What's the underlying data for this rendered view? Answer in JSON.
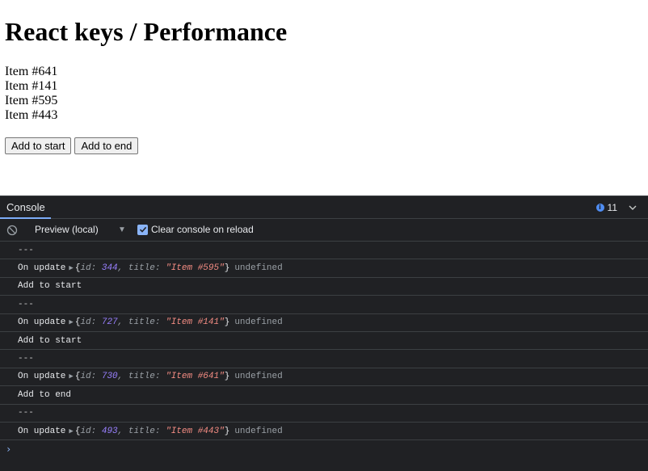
{
  "page": {
    "title": "React keys / Performance",
    "items": [
      "Item #641",
      "Item #141",
      "Item #595",
      "Item #443"
    ],
    "buttons": {
      "add_start": "Add to start",
      "add_end": "Add to end"
    }
  },
  "devtools": {
    "tab_label": "Console",
    "info_count": "11",
    "context_label": "Preview (local)",
    "clear_on_reload_label": "Clear console on reload",
    "clear_on_reload_checked": true,
    "log": [
      {
        "type": "text",
        "text": "---"
      },
      {
        "type": "update",
        "label": "On update",
        "id": "344",
        "title": "\"Item #595\"",
        "suffix": "undefined"
      },
      {
        "type": "text",
        "text": "Add to start"
      },
      {
        "type": "text",
        "text": "---"
      },
      {
        "type": "update",
        "label": "On update",
        "id": "727",
        "title": "\"Item #141\"",
        "suffix": "undefined"
      },
      {
        "type": "text",
        "text": "Add to start"
      },
      {
        "type": "text",
        "text": "---"
      },
      {
        "type": "update",
        "label": "On update",
        "id": "730",
        "title": "\"Item #641\"",
        "suffix": "undefined"
      },
      {
        "type": "text",
        "text": "Add to end"
      },
      {
        "type": "text",
        "text": "---"
      },
      {
        "type": "update",
        "label": "On update",
        "id": "493",
        "title": "\"Item #443\"",
        "suffix": "undefined"
      }
    ],
    "prompt_symbol": "›",
    "colors": {
      "accent": "#8ab4f8",
      "number": "#9980ff",
      "string": "#f28b82",
      "info": "#4f8df3"
    }
  }
}
